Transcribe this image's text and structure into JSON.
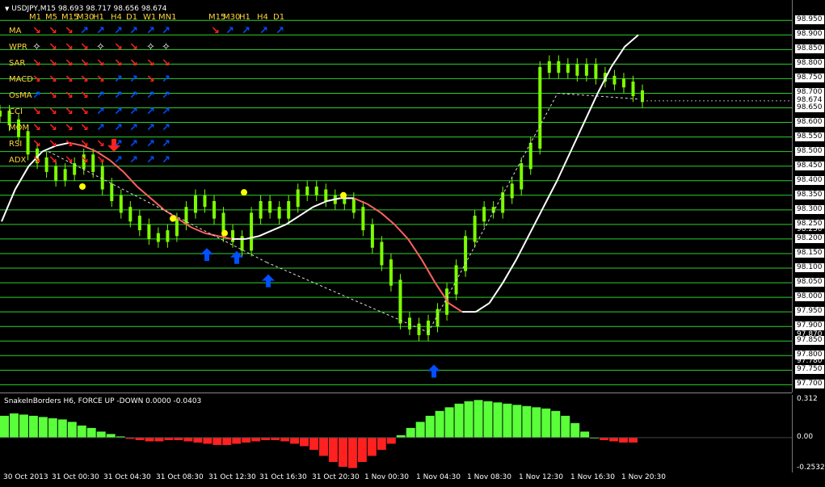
{
  "header": {
    "symbol_line": "USDJPY,M15  98.693 98.717 98.656 98.674"
  },
  "matrix": {
    "timeframes_left": [
      "M1",
      "M5",
      "M15",
      "M30",
      "H1",
      "H4",
      "D1",
      "W1",
      "MN1"
    ],
    "timeframes_right": [
      "M15",
      "M30",
      "H1",
      "H4",
      "D1"
    ],
    "rows": [
      {
        "label": "MA",
        "left": [
          "down",
          "down",
          "down",
          "up",
          "up",
          "up",
          "up",
          "up",
          "up"
        ],
        "right": [
          "down",
          "up",
          "up",
          "up",
          "up"
        ]
      },
      {
        "label": "WPR",
        "left": [
          "star",
          "down",
          "down",
          "down",
          "star",
          "down",
          "down",
          "star",
          "star"
        ],
        "right": []
      },
      {
        "label": "SAR",
        "left": [
          "down",
          "down",
          "down",
          "down",
          "down",
          "down",
          "down",
          "down",
          "down"
        ],
        "right": []
      },
      {
        "label": "MACD",
        "left": [
          "down",
          "down",
          "down",
          "down",
          "down",
          "up",
          "up",
          "down",
          "up"
        ],
        "right": []
      },
      {
        "label": "OsMA",
        "left": [
          "up",
          "down",
          "down",
          "down",
          "up",
          "up",
          "up",
          "up",
          "up"
        ],
        "right": []
      },
      {
        "label": "CCI",
        "left": [
          "down",
          "down",
          "down",
          "down",
          "up",
          "up",
          "up",
          "up",
          "up"
        ],
        "right": []
      },
      {
        "label": "MOM",
        "left": [
          "down",
          "down",
          "down",
          "down",
          "up",
          "up",
          "up",
          "up",
          "up"
        ],
        "right": []
      },
      {
        "label": "RSI",
        "left": [
          "down",
          "down",
          "down",
          "down",
          "down",
          "up",
          "up",
          "up",
          "up"
        ],
        "right": []
      },
      {
        "label": "ADX",
        "left": [
          "down",
          "down",
          "down",
          "down",
          "down",
          "up",
          "up",
          "up",
          "up"
        ],
        "right": []
      }
    ]
  },
  "indicator": {
    "title": "SnakeInBorders H6, FORCE UP -DOWN  0.0000 -0.0403",
    "scale_labels": [
      "0.312",
      "0.00",
      "-0.2532"
    ]
  },
  "colors": {
    "candle": "#7CFC00",
    "grid": "#2bd12b",
    "snake_up": "#ffffff",
    "snake_down": "#ff6060",
    "arrow_up": "#0050ff",
    "arrow_down": "#ff2020",
    "dot": "#ffff00",
    "hist_pos": "#5aff3a",
    "hist_neg": "#ff2020"
  },
  "chart_data": {
    "type": "line",
    "title": "USDJPY,M15",
    "ohlc_current": {
      "open": 98.693,
      "high": 98.717,
      "low": 98.656,
      "close": 98.674
    },
    "price_axis_labels": [
      "98.950",
      "98.900",
      "98.850",
      "98.800",
      "98.750",
      "98.700",
      "98.674",
      "98.650",
      "98.600",
      "98.550",
      "98.500",
      "98.450",
      "98.400",
      "98.350",
      "98.300",
      "98.250",
      "98.230",
      "98.200",
      "98.150",
      "98.100",
      "98.050",
      "98.000",
      "97.950",
      "97.900",
      "97.870",
      "97.850",
      "97.800",
      "97.780",
      "97.750",
      "97.700"
    ],
    "grid_levels": [
      98.95,
      98.9,
      98.85,
      98.8,
      98.75,
      98.7,
      98.65,
      98.6,
      98.55,
      98.5,
      98.45,
      98.4,
      98.35,
      98.3,
      98.25,
      98.2,
      98.15,
      98.1,
      98.05,
      98.0,
      97.95,
      97.9,
      97.85,
      97.8,
      97.75,
      97.7
    ],
    "x_tick_labels": [
      "30 Oct 2013",
      "31 Oct 00:30",
      "31 Oct 04:30",
      "31 Oct 08:30",
      "31 Oct 12:30",
      "31 Oct 16:30",
      "31 Oct 20:30",
      "1 Nov 00:30",
      "1 Nov 04:30",
      "1 Nov 08:30",
      "1 Nov 12:30",
      "1 Nov 16:30",
      "1 Nov 20:30"
    ],
    "ylim": [
      97.69,
      98.97
    ],
    "series": [
      {
        "values": [
          98.63,
          98.6,
          98.56,
          98.5,
          98.47,
          98.44,
          98.41,
          98.43,
          98.45,
          98.48,
          98.44,
          98.38,
          98.34,
          98.3,
          98.27,
          98.24,
          98.21,
          98.2,
          98.22,
          98.26,
          98.3,
          98.34,
          98.32,
          98.28,
          98.22,
          98.2,
          98.17,
          98.28,
          98.32,
          98.3,
          98.28,
          98.32,
          98.36,
          98.37,
          98.36,
          98.34,
          98.33,
          98.33,
          98.3,
          98.24,
          98.18,
          98.12,
          98.05,
          97.92,
          97.9,
          97.88,
          97.91,
          97.95,
          98.02,
          98.1,
          98.2,
          98.27,
          98.3,
          98.3,
          98.35,
          98.38,
          98.45,
          98.52,
          98.78,
          98.8,
          98.78,
          98.79,
          98.77,
          98.79,
          98.76,
          98.75,
          98.74,
          98.73,
          98.7,
          98.68
        ]
      },
      {
        "values": [
          98.26,
          98.37,
          98.45,
          98.5,
          98.52,
          98.53,
          98.52,
          98.5,
          98.47,
          98.43,
          98.38,
          98.34,
          98.3,
          98.27,
          98.24,
          98.22,
          98.21,
          98.2,
          98.2,
          98.21,
          98.23,
          98.25,
          98.28,
          98.31,
          98.33,
          98.34,
          98.34,
          98.32,
          98.29,
          98.25,
          98.2,
          98.13,
          98.05,
          97.98,
          97.95,
          97.95,
          97.98,
          98.05,
          98.13,
          98.22,
          98.31,
          98.4,
          98.5,
          98.6,
          98.7,
          98.79,
          98.86,
          98.9
        ]
      }
    ],
    "markers": {
      "buy_arrows": [
        98.18,
        98.17,
        98.09,
        97.78
      ],
      "dots": [
        98.38,
        98.27,
        98.22,
        98.36,
        98.35
      ]
    },
    "indicator_histogram": [
      0.18,
      0.2,
      0.19,
      0.18,
      0.17,
      0.16,
      0.15,
      0.13,
      0.1,
      0.08,
      0.05,
      0.03,
      0.01,
      -0.01,
      -0.02,
      -0.03,
      -0.03,
      -0.02,
      -0.02,
      -0.03,
      -0.04,
      -0.05,
      -0.06,
      -0.06,
      -0.05,
      -0.04,
      -0.03,
      -0.02,
      -0.02,
      -0.03,
      -0.05,
      -0.07,
      -0.1,
      -0.15,
      -0.2,
      -0.24,
      -0.25,
      -0.2,
      -0.15,
      -0.1,
      -0.05,
      0.02,
      0.08,
      0.13,
      0.18,
      0.22,
      0.25,
      0.28,
      0.3,
      0.31,
      0.3,
      0.29,
      0.28,
      0.27,
      0.26,
      0.25,
      0.24,
      0.22,
      0.18,
      0.12,
      0.05,
      0.0,
      -0.02,
      -0.03,
      -0.04,
      -0.04
    ]
  }
}
